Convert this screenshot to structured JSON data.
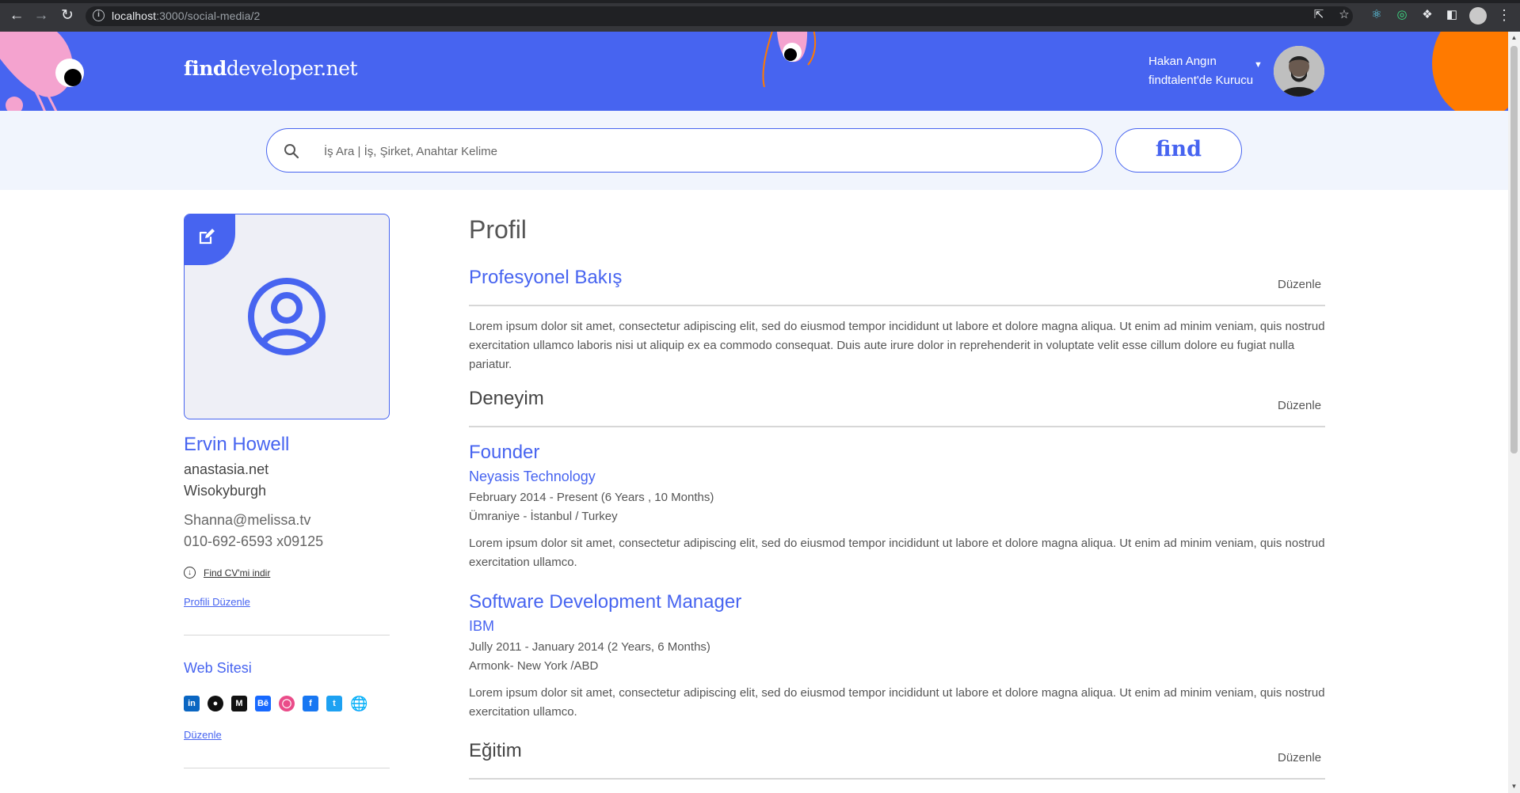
{
  "browser": {
    "url_host": "localhost",
    "url_path": ":3000/social-media/2"
  },
  "header": {
    "logo_bold": "find",
    "logo_rest": "developer.net",
    "user_name": "Hakan Angın",
    "user_role": "findtalent'de Kurucu"
  },
  "search": {
    "placeholder": "İş Ara | İş, Şirket, Anahtar Kelime",
    "button_label": "find"
  },
  "sidebar": {
    "name": "Ervin Howell",
    "website": "anastasia.net",
    "city": "Wisokyburgh",
    "email": "Shanna@melissa.tv",
    "phone": "010-692-6593 x09125",
    "cv_link": "Find CV'mi indir",
    "edit_profile": "Profili Düzenle",
    "web_title": "Web Sitesi",
    "web_edit": "Düzenle",
    "socials": [
      "linkedin-icon",
      "github-icon",
      "medium-icon",
      "behance-icon",
      "dribbble-icon",
      "facebook-icon",
      "twitter-icon",
      "globe-icon"
    ]
  },
  "main": {
    "title": "Profil",
    "overview": {
      "title": "Profesyonel Bakış",
      "edit": "Düzenle",
      "text": "Lorem ipsum dolor sit amet, consectetur adipiscing elit, sed do eiusmod tempor incididunt ut labore et dolore magna aliqua. Ut enim ad minim veniam, quis nostrud exercitation ullamco laboris nisi ut aliquip ex ea commodo consequat. Duis aute irure dolor in reprehenderit in voluptate velit esse cillum dolore eu fugiat nulla pariatur."
    },
    "experience": {
      "title": "Deneyim",
      "edit": "Düzenle",
      "jobs": [
        {
          "title": "Founder",
          "company": "Neyasis Technology",
          "dates": "February 2014 - Present (6 Years , 10 Months)",
          "location": "Ümraniye - İstanbul / Turkey",
          "desc": "Lorem ipsum dolor sit amet, consectetur adipiscing elit, sed do eiusmod tempor incididunt ut labore et dolore magna aliqua. Ut enim ad minim veniam, quis nostrud exercitation ullamco."
        },
        {
          "title": "Software Development Manager",
          "company": "IBM",
          "dates": "Jully 2011 - January 2014 (2 Years, 6 Months)",
          "location": "Armonk- New York /ABD",
          "desc": "Lorem ipsum dolor sit amet, consectetur adipiscing elit, sed do eiusmod tempor incididunt ut labore et dolore magna aliqua. Ut enim ad minim veniam, quis nostrud exercitation ullamco."
        }
      ]
    },
    "education": {
      "title": "Eğitim",
      "edit": "Düzenle"
    }
  },
  "colors": {
    "brand": "#4764f0",
    "accent_orange": "#ff7a00",
    "accent_pink": "#f4a3cf"
  }
}
